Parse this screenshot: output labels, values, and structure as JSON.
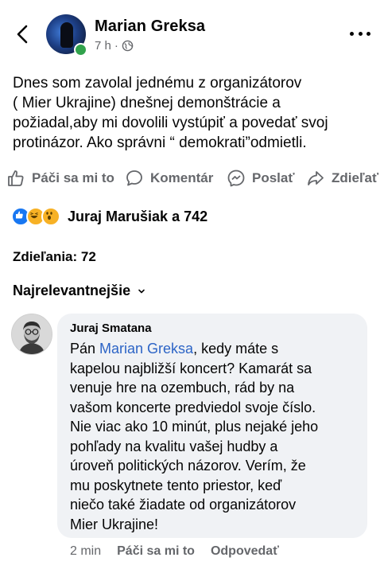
{
  "post": {
    "author": "Marian Greksa",
    "time": "7 h",
    "separator": "·",
    "text": "Dnes som zavolal jednému z organizátorov\n( Mier Ukrajine) dnešnej demonštrácie a\npožiadal,aby mi dovolili vystúpiť a povedať svoj\nprotinázor. Ako správni “ demokrati”odmietli."
  },
  "actions": {
    "like": "Páči sa mi to",
    "comment": "Komentár",
    "send": "Poslať",
    "share": "Zdieľať"
  },
  "reactions": {
    "icons": [
      "like-icon",
      "haha-icon",
      "wow-icon"
    ],
    "summary": "Juraj Marušiak a 742"
  },
  "shares": "Zdieľania: 72",
  "sort": {
    "label": "Najrelevantnejšie"
  },
  "comment": {
    "author": "Juraj Smatana",
    "text_before": "Pán ",
    "mention": "Marian Greksa",
    "text_after": ", kedy máte s\nkapelou najbližší koncert? Kamarát sa\nvenuje hre na ozembuch, rád by na\nvašom koncerte predviedol svoje číslo.\nNie viac ako 10 minút, plus nejaké jeho\npohľady na kvalitu vašej hudby a\núroveň politických názorov. Verím, že\nmu poskytnete tento priestor, keď\nniečo také žiadate od organizátorov\nMier Ukrajine!",
    "time": "2 min",
    "like": "Páči sa mi to",
    "reply": "Odpovedať"
  },
  "colors": {
    "text": "#050505",
    "secondary": "#65676b",
    "mention": "#2c64c6",
    "online": "#31a24c",
    "like": "#1877f2",
    "bubble": "#f0f2f5"
  }
}
